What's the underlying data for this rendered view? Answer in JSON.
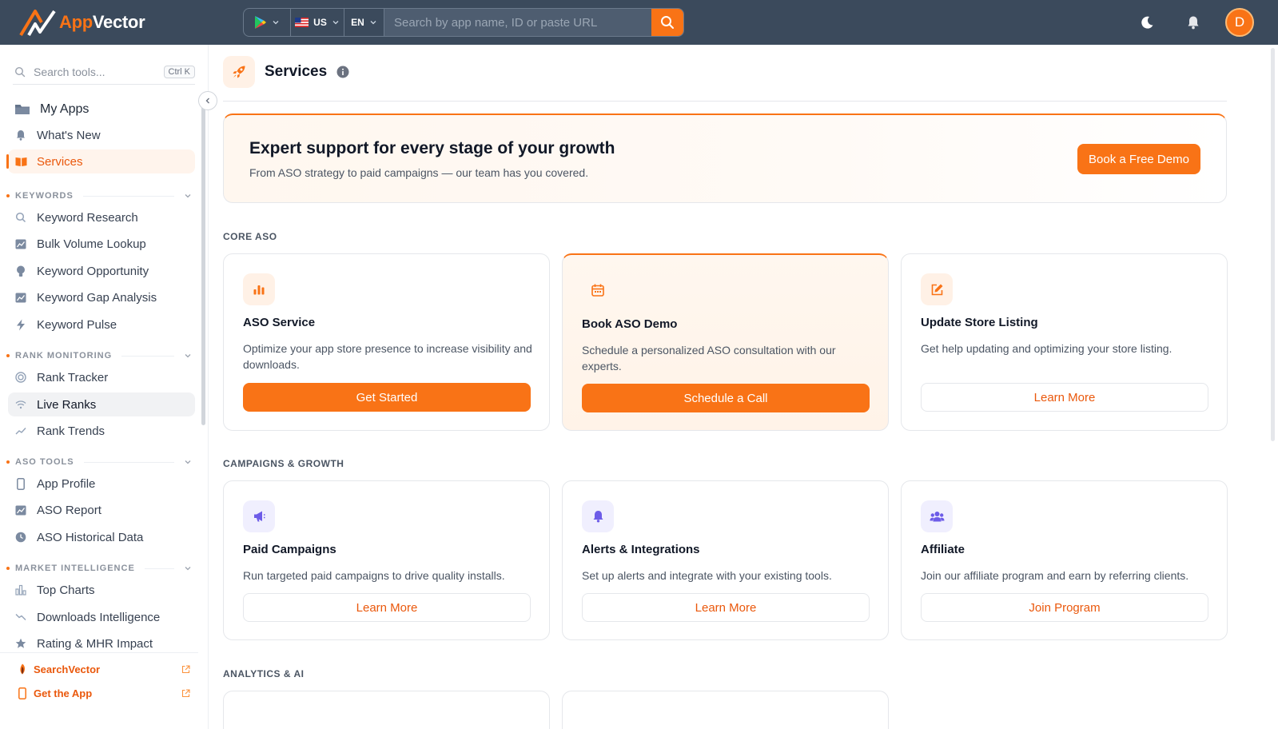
{
  "app": {
    "name_part1": "App",
    "name_part2": "Vector"
  },
  "topbar": {
    "store_icon": "google-play-icon",
    "country": "US",
    "language": "EN",
    "search_placeholder": "Search by app name, ID or paste URL",
    "avatar_initial": "D"
  },
  "sidebar": {
    "search_placeholder": "Search tools...",
    "search_shortcut": "Ctrl K",
    "top_items": [
      {
        "label": "My Apps",
        "icon": "folder-icon"
      },
      {
        "label": "What's New",
        "icon": "bell-icon"
      },
      {
        "label": "Services",
        "icon": "book-open-icon"
      }
    ],
    "sections": [
      {
        "title": "KEYWORDS",
        "items": [
          {
            "label": "Keyword Research",
            "icon": "search-icon"
          },
          {
            "label": "Bulk Volume Lookup",
            "icon": "chart-area-icon"
          },
          {
            "label": "Keyword Opportunity",
            "icon": "lightbulb-icon"
          },
          {
            "label": "Keyword Gap Analysis",
            "icon": "chart-area-icon"
          },
          {
            "label": "Keyword Pulse",
            "icon": "bolt-icon"
          }
        ]
      },
      {
        "title": "RANK MONITORING",
        "items": [
          {
            "label": "Rank Tracker",
            "icon": "target-icon"
          },
          {
            "label": "Live Ranks",
            "icon": "wifi-icon"
          },
          {
            "label": "Rank Trends",
            "icon": "trend-up-icon"
          }
        ]
      },
      {
        "title": "ASO TOOLS",
        "items": [
          {
            "label": "App Profile",
            "icon": "phone-icon"
          },
          {
            "label": "ASO Report",
            "icon": "chart-area-icon"
          },
          {
            "label": "ASO Historical Data",
            "icon": "clock-icon"
          }
        ]
      },
      {
        "title": "MARKET INTELLIGENCE",
        "items": [
          {
            "label": "Top Charts",
            "icon": "bar-chart-icon"
          },
          {
            "label": "Downloads Intelligence",
            "icon": "trend-down-icon"
          },
          {
            "label": "Rating & MHR Impact",
            "icon": "star-icon"
          }
        ]
      }
    ],
    "links": [
      {
        "label": "SearchVector",
        "icon": "searchvector-logo-icon"
      },
      {
        "label": "Get the App",
        "icon": "phone-icon"
      }
    ]
  },
  "page": {
    "title": "Services",
    "hero": {
      "title": "Expert support for every stage of your growth",
      "subtitle": "From ASO strategy to paid campaigns — our team has you covered.",
      "button": "Book a Free Demo"
    },
    "sections": [
      {
        "label": "CORE ASO",
        "cards": [
          {
            "title": "ASO Service",
            "desc": "Optimize your app store presence to increase visibility and downloads.",
            "button": "Get Started",
            "icon": "bar-chart-icon"
          },
          {
            "title": "Book ASO Demo",
            "desc": "Schedule a personalized ASO consultation with our experts.",
            "button": "Schedule a Call",
            "icon": "calendar-icon"
          },
          {
            "title": "Update Store Listing",
            "desc": "Get help updating and optimizing your store listing.",
            "button": "Learn More",
            "icon": "edit-icon"
          }
        ]
      },
      {
        "label": "CAMPAIGNS & GROWTH",
        "cards": [
          {
            "title": "Paid Campaigns",
            "desc": "Run targeted paid campaigns to drive quality installs.",
            "button": "Learn More",
            "icon": "megaphone-icon"
          },
          {
            "title": "Alerts & Integrations",
            "desc": "Set up alerts and integrate with your existing tools.",
            "button": "Learn More",
            "icon": "bell-icon"
          },
          {
            "title": "Affiliate",
            "desc": "Join our affiliate program and earn by referring clients.",
            "button": "Join Program",
            "icon": "users-icon"
          }
        ]
      },
      {
        "label": "ANALYTICS & AI",
        "cards": []
      }
    ]
  },
  "colors": {
    "accent": "#f97316",
    "topbar": "#3b4a5c",
    "purple": "#6d5ce8"
  }
}
